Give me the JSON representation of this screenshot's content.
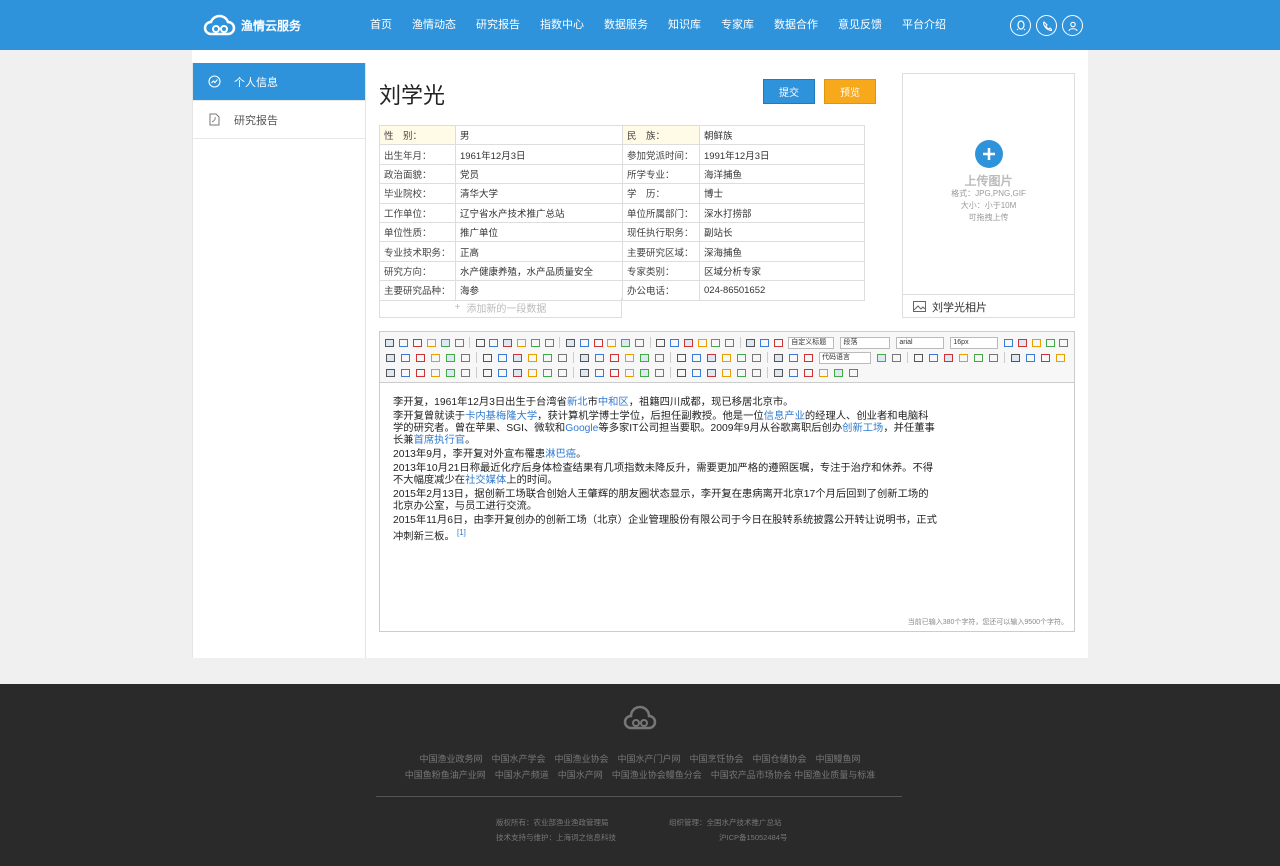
{
  "header": {
    "logo_text": "渔情云服务",
    "nav": [
      "首页",
      "渔情动态",
      "研究报告",
      "指数中心",
      "数据服务",
      "知识库",
      "专家库",
      "数据合作",
      "意见反馈",
      "平台介绍"
    ],
    "icons": [
      "qq-icon",
      "phone-icon",
      "user-icon"
    ]
  },
  "sidebar": {
    "items": [
      {
        "label": "个人信息",
        "icon": "trend-icon",
        "active": true
      },
      {
        "label": "研究报告",
        "icon": "pdf-icon",
        "active": false
      }
    ]
  },
  "profile": {
    "name": "刘学光",
    "submit_label": "提交",
    "preview_label": "预览",
    "add_row": "添加新的一段数据",
    "rows": [
      {
        "l1": "性　别：",
        "v1": "男",
        "l2": "民　族：",
        "v2": "朝鲜族"
      },
      {
        "l1": "出生年月：",
        "v1": "1961年12月3日",
        "l2": "参加党派时间：",
        "v2": "1991年12月3日"
      },
      {
        "l1": "政治面貌：",
        "v1": "党员",
        "l2": "所学专业：",
        "v2": "海洋捕鱼"
      },
      {
        "l1": "毕业院校：",
        "v1": "清华大学",
        "l2": "学　历：",
        "v2": "博士"
      },
      {
        "l1": "工作单位：",
        "v1": "辽宁省水产技术推广总站",
        "l2": "单位所属部门：",
        "v2": "深水打捞部"
      },
      {
        "l1": "单位性质：",
        "v1": "推广单位",
        "l2": "现任执行职务：",
        "v2": "副站长"
      },
      {
        "l1": "专业技术职务：",
        "v1": "正高",
        "l2": "主要研究区域：",
        "v2": "深海捕鱼"
      },
      {
        "l1": "研究方向：",
        "v1": "水产健康养殖，水产品质量安全",
        "l2": "专家类别：",
        "v2": "区域分析专家"
      },
      {
        "l1": "主要研究品种：",
        "v1": "海参",
        "l2": "办公电话：",
        "v2": "024-86501652"
      }
    ]
  },
  "photo": {
    "upload_label": "上传图片",
    "format": "格式：JPG,PNG,GIF",
    "size": "大小：小于10M",
    "drag": "可拖拽上传",
    "caption": "刘学光相片"
  },
  "editor": {
    "selects": [
      "自定义标题",
      "段落",
      "arial",
      "16px",
      "代码语言"
    ],
    "counter": "当前已输入380个字符，您还可以输入9500个字符。",
    "paragraphs": [
      [
        {
          "t": "李开复，1961年12月3日出生于台湾省"
        },
        {
          "t": "新北",
          "a": 1
        },
        {
          "t": "市"
        },
        {
          "t": "中和区",
          "a": 1
        },
        {
          "t": "，祖籍四川成都，现已移居北京市。"
        }
      ],
      [
        {
          "t": "李开复曾就读于"
        },
        {
          "t": "卡内基梅隆大学",
          "a": 1
        },
        {
          "t": "，获计算机学博士学位，后担任副教授。他是一位"
        },
        {
          "t": "信息产业",
          "a": 1
        },
        {
          "t": "的经理人、创业者和电脑科学的研究者。曾在苹果、SGI、微软和"
        },
        {
          "t": "Google",
          "a": 1
        },
        {
          "t": "等多家IT公司担当要职。2009年9月从谷歌离职后创办"
        },
        {
          "t": "创新工场",
          "a": 1
        },
        {
          "t": "，并任董事长兼"
        },
        {
          "t": "首席执行官",
          "a": 1
        },
        {
          "t": "。"
        }
      ],
      [
        {
          "t": "2013年9月，李开复对外宣布罹患"
        },
        {
          "t": "淋巴癌",
          "a": 1
        },
        {
          "t": "。"
        }
      ],
      [
        {
          "t": "2013年10月21日称最近化疗后身体检查结果有几项指数未降反升，需要更加严格的遵照医嘱，专注于治疗和休养。不得不大幅度减少在"
        },
        {
          "t": "社交媒体",
          "a": 1
        },
        {
          "t": "上的时间。"
        }
      ],
      [
        {
          "t": "2015年2月13日，据创新工场联合创始人王肇辉的朋友圈状态显示，李开复在患病离开北京17个月后回到了创新工场的北京办公室，与员工进行交流。"
        }
      ],
      [
        {
          "t": "2015年11月6日，由李开复创办的创新工场（北京）企业管理股份有限公司于今日在股转系统披露公开转让说明书，正式冲刺新三板。"
        },
        {
          "t": " [1]",
          "a": 1
        }
      ]
    ]
  },
  "footer": {
    "links1": "中国渔业政务网　中国水产学会　中国渔业协会　中国水产门户网　中国烹饪协会　中国仓储协会　中国鳗鱼网",
    "links2": "中国鱼粉鱼油产业网　中国水产频道　中国水产网　中国渔业协会鳗鱼分会　中国农产品市场协会 中国渔业质量与标准",
    "copyright": "版权所有：农业部渔业渔政管理局",
    "org": "组织管理：全国水产技术推广总站",
    "support": "技术支持与维护：上海词之信息科技",
    "icp": "沪ICP备15052484号"
  }
}
